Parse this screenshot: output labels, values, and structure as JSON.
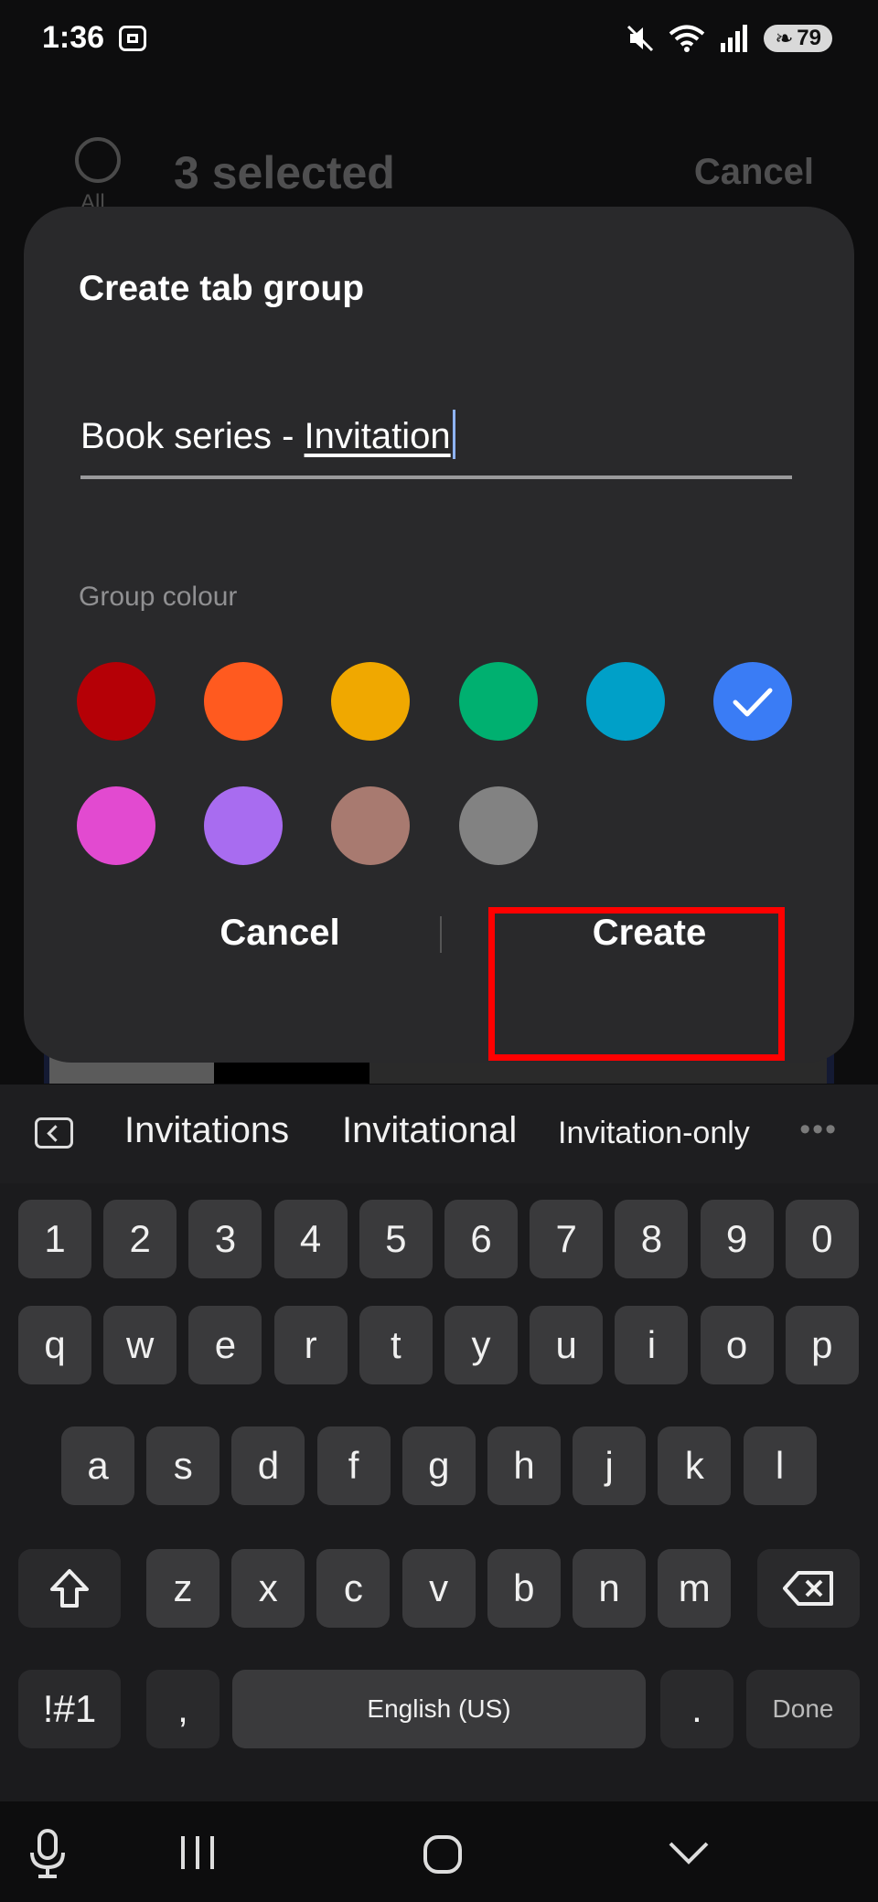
{
  "status_bar": {
    "time": "1:36",
    "battery": "79"
  },
  "background": {
    "select_all_label": "All",
    "title": "3 selected",
    "cancel_label": "Cancel"
  },
  "dialog": {
    "title": "Create tab group",
    "input_value_prefix": "Book series - ",
    "input_value_composing": "Invitation",
    "colour_label": "Group colour",
    "colours": [
      "#b50006",
      "#ff5a1f",
      "#f0a800",
      "#00b070",
      "#00a0c8",
      "#3a7cf5",
      "#e24ad0",
      "#a86cf0",
      "#a87a70",
      "#828282"
    ],
    "selected_colour": "#3a7cf5",
    "cancel_label": "Cancel",
    "create_label": "Create"
  },
  "suggestions": [
    "Invitations",
    "Invitational",
    "Invitation-only"
  ],
  "keyboard": {
    "numbers": [
      "1",
      "2",
      "3",
      "4",
      "5",
      "6",
      "7",
      "8",
      "9",
      "0"
    ],
    "row1": [
      "q",
      "w",
      "e",
      "r",
      "t",
      "y",
      "u",
      "i",
      "o",
      "p"
    ],
    "row2": [
      "a",
      "s",
      "d",
      "f",
      "g",
      "h",
      "j",
      "k",
      "l"
    ],
    "row3": [
      "z",
      "x",
      "c",
      "v",
      "b",
      "n",
      "m"
    ],
    "symbols_label": "!#1",
    "comma": ",",
    "space_label": "English (US)",
    "period": ".",
    "done_label": "Done"
  }
}
